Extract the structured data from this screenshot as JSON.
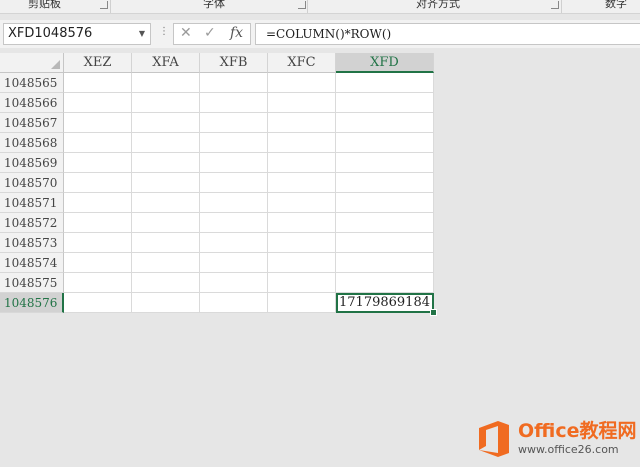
{
  "ribbon": {
    "groups": [
      "剪贴板",
      "字体",
      "对齐方式",
      "数字"
    ]
  },
  "formula_bar": {
    "name_box": "XFD1048576",
    "formula": "=COLUMN()*ROW()"
  },
  "sheet": {
    "columns": [
      "XEZ",
      "XFA",
      "XFB",
      "XFC",
      "XFD"
    ],
    "selected_column": "XFD",
    "rows": [
      "1048565",
      "1048566",
      "1048567",
      "1048568",
      "1048569",
      "1048570",
      "1048571",
      "1048572",
      "1048573",
      "1048574",
      "1048575",
      "1048576"
    ],
    "selected_row": "1048576",
    "active_cell_value": "17179869184"
  },
  "watermark": {
    "brand": "Office教程网",
    "url": "www.office26.com"
  },
  "colors": {
    "accent": "#217346",
    "brand": "#f06b21"
  }
}
